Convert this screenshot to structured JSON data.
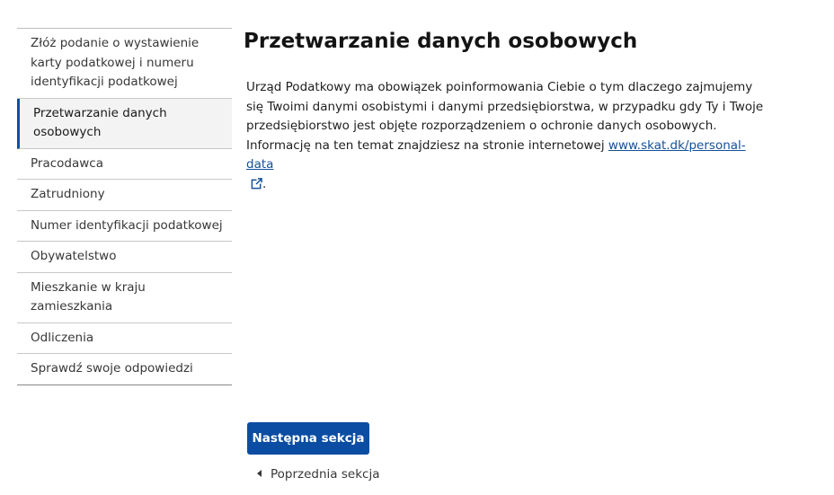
{
  "sidebar": {
    "items": [
      {
        "label": "Złóż podanie o wystawienie karty podatkowej i numeru identyfikacji podatkowej"
      },
      {
        "label": "Przetwarzanie danych osobowych"
      },
      {
        "label": "Pracodawca"
      },
      {
        "label": "Zatrudniony"
      },
      {
        "label": "Numer identyfikacji podatkowej"
      },
      {
        "label": "Obywatelstwo"
      },
      {
        "label": "Mieszkanie w kraju zamieszkania"
      },
      {
        "label": "Odliczenia"
      },
      {
        "label": "Sprawdź swoje odpowiedzi"
      }
    ]
  },
  "main": {
    "title": "Przetwarzanie danych osobowych",
    "intro_text": "Urząd Podatkowy ma obowiązek poinformowania Ciebie o tym dlaczego zajmujemy się Twoimi danymi osobistymi i danymi przedsiębiorstwa, w przypadku gdy Ty i Twoje przedsiębiorstwo jest objęte rozporządzeniem o ochronie danych osobowych. Informację na ten temat znajdziesz na stronie internetowej ",
    "link_text": "www.skat.dk/personal-data",
    "link_icon": "external-link-icon",
    "intro_end": "."
  },
  "footer": {
    "next_label": "Następna sekcja",
    "prev_label": "Poprzednia sekcja",
    "prev_icon": "triangle-left-icon"
  },
  "colors": {
    "accent": "#0b4da2",
    "link": "#14509a"
  }
}
